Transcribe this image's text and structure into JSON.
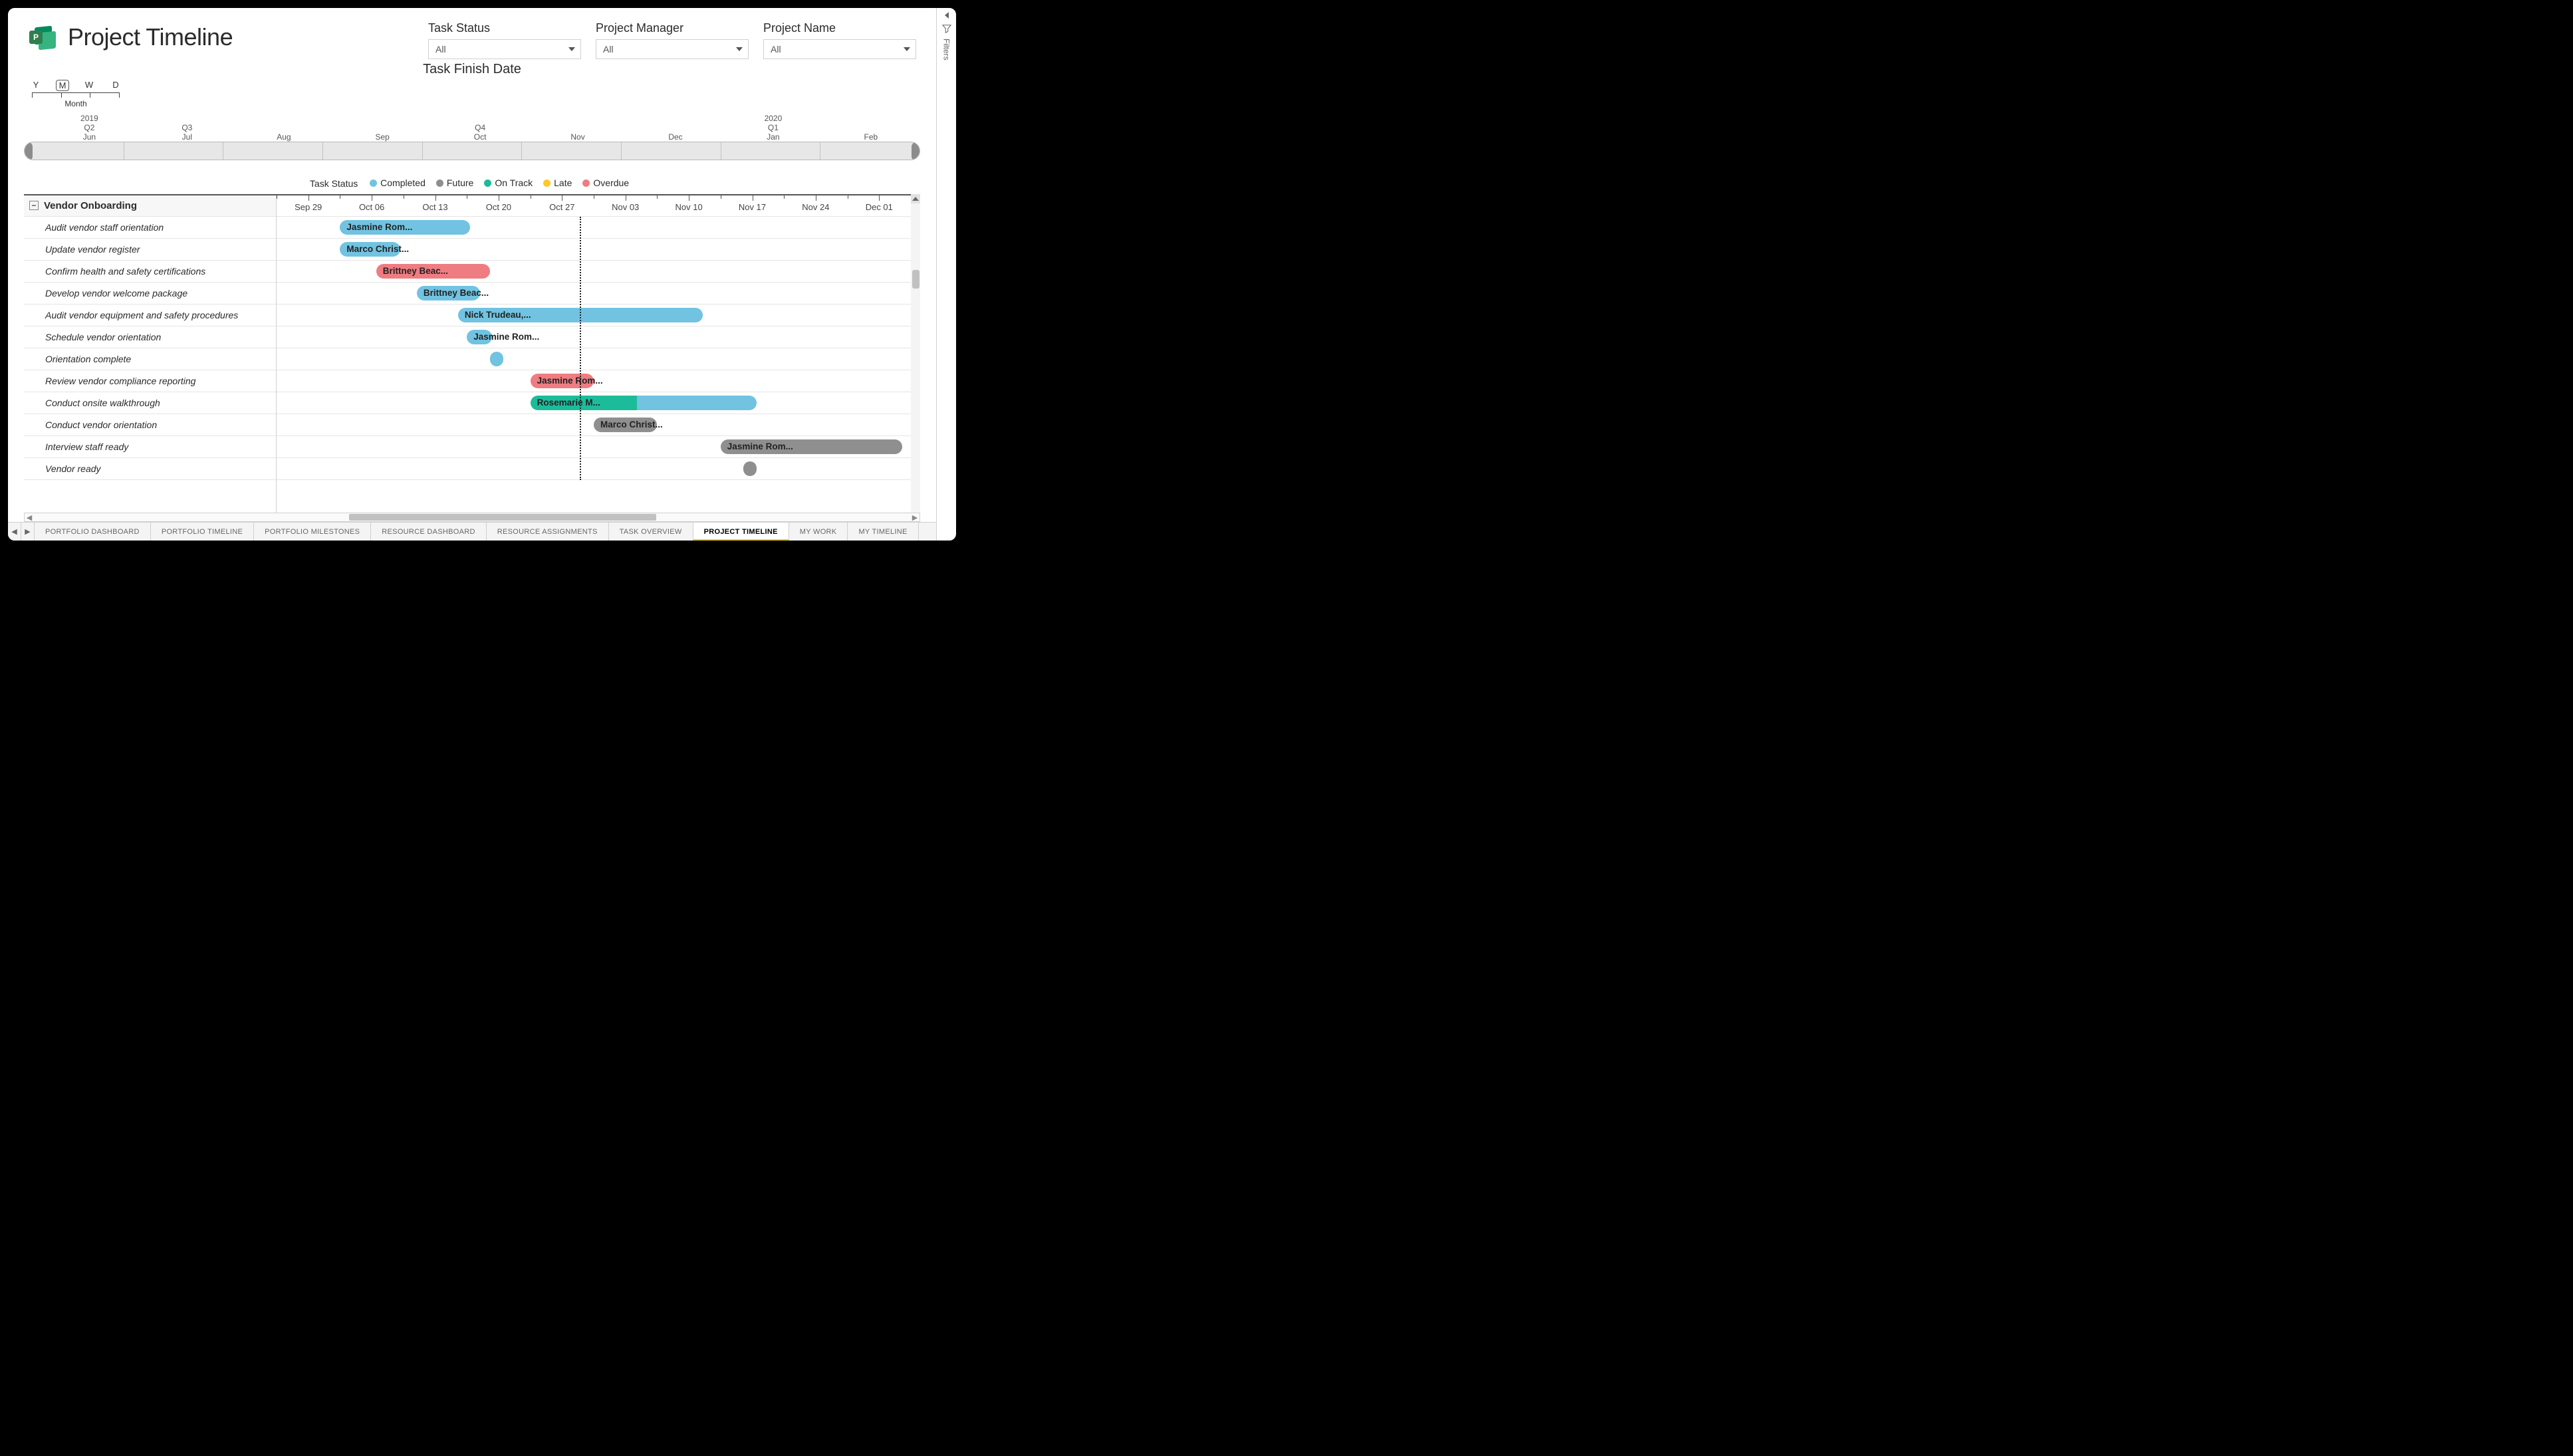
{
  "header": {
    "title": "Project Timeline",
    "logo_letter": "P"
  },
  "slicers": [
    {
      "label": "Task Status",
      "value": "All"
    },
    {
      "label": "Project Manager",
      "value": "All"
    },
    {
      "label": "Project Name",
      "value": "All"
    }
  ],
  "filters_panel_label": "Filters",
  "chart_title": "Task Finish Date",
  "granularity": {
    "options": [
      "Y",
      "M",
      "W",
      "D"
    ],
    "selected": "M",
    "selected_label": "Month"
  },
  "time_scroller": {
    "years": [
      {
        "label": "2019",
        "pos_pct": 7.3
      },
      {
        "label": "2020",
        "pos_pct": 83.6
      }
    ],
    "quarters": [
      {
        "label": "Q2",
        "pos_pct": 7.3
      },
      {
        "label": "Q3",
        "pos_pct": 18.2
      },
      {
        "label": "Q4",
        "pos_pct": 50.9
      },
      {
        "label": "Q1",
        "pos_pct": 83.6
      }
    ],
    "months": [
      {
        "label": "Jun",
        "pos_pct": 7.3
      },
      {
        "label": "Jul",
        "pos_pct": 18.2
      },
      {
        "label": "Aug",
        "pos_pct": 29.0
      },
      {
        "label": "Sep",
        "pos_pct": 40.0
      },
      {
        "label": "Oct",
        "pos_pct": 50.9
      },
      {
        "label": "Nov",
        "pos_pct": 61.8
      },
      {
        "label": "Dec",
        "pos_pct": 72.7
      },
      {
        "label": "Jan",
        "pos_pct": 83.6
      },
      {
        "label": "Feb",
        "pos_pct": 94.5
      }
    ]
  },
  "legend": {
    "title": "Task Status",
    "items": [
      {
        "label": "Completed",
        "color": "#71c3e1"
      },
      {
        "label": "Future",
        "color": "#8f8f8f"
      },
      {
        "label": "On Track",
        "color": "#1cbc9a"
      },
      {
        "label": "Late",
        "color": "#ffc828"
      },
      {
        "label": "Overdue",
        "color": "#ef7c81"
      }
    ]
  },
  "gantt": {
    "group": "Vendor Onboarding",
    "origin": "2019-09-26",
    "today_pct": 47.8,
    "date_ticks": [
      "Sep 29",
      "Oct 06",
      "Oct 13",
      "Oct 20",
      "Oct 27",
      "Nov 03",
      "Nov 10",
      "Nov 17",
      "Nov 24",
      "Dec 01"
    ],
    "tick_start_pct": 5,
    "tick_step_pct": 10,
    "tasks": [
      {
        "name": "Audit vendor staff orientation",
        "label": "Jasmine Rom...",
        "start_pct": 10.0,
        "width_pct": 20.5,
        "segments": [
          {
            "c": "completed",
            "pct": 100
          }
        ]
      },
      {
        "name": "Update vendor register",
        "label": "Marco Christ...",
        "start_pct": 10.0,
        "width_pct": 9.5,
        "segments": [
          {
            "c": "completed",
            "pct": 100
          }
        ]
      },
      {
        "name": "Confirm health and safety certifications",
        "label": "Brittney Beac...",
        "start_pct": 15.7,
        "width_pct": 18.0,
        "segments": [
          {
            "c": "overdue",
            "pct": 100
          }
        ]
      },
      {
        "name": "Develop vendor welcome package",
        "label": "Brittney Beac...",
        "start_pct": 22.1,
        "width_pct": 10.0,
        "segments": [
          {
            "c": "completed",
            "pct": 100
          }
        ]
      },
      {
        "name": "Audit vendor equipment and safety procedures",
        "label": "Nick Trudeau,...",
        "start_pct": 28.6,
        "width_pct": 38.6,
        "segments": [
          {
            "c": "completed",
            "pct": 100
          }
        ]
      },
      {
        "name": "Schedule vendor orientation",
        "label": "Jasmine Rom...",
        "start_pct": 30.0,
        "width_pct": 4.0,
        "segments": [
          {
            "c": "completed",
            "pct": 100
          }
        ]
      },
      {
        "name": "Orientation complete",
        "label": "",
        "start_pct": 33.6,
        "width_pct": 1.6,
        "segments": [
          {
            "c": "completed",
            "pct": 100
          }
        ]
      },
      {
        "name": "Review vendor compliance reporting",
        "label": "Jasmine Rom...",
        "start_pct": 40.0,
        "width_pct": 10.0,
        "segments": [
          {
            "c": "overdue",
            "pct": 100
          }
        ]
      },
      {
        "name": "Conduct onsite walkthrough",
        "label": "Rosemarie M...",
        "start_pct": 40.0,
        "width_pct": 35.7,
        "segments": [
          {
            "c": "ontrack",
            "pct": 47
          },
          {
            "c": "completed",
            "pct": 53
          }
        ]
      },
      {
        "name": "Conduct vendor orientation",
        "label": "Marco Christ...",
        "start_pct": 50.0,
        "width_pct": 10.0,
        "segments": [
          {
            "c": "future",
            "pct": 100
          }
        ]
      },
      {
        "name": "Interview staff ready",
        "label": "Jasmine Rom...",
        "start_pct": 70.0,
        "width_pct": 28.6,
        "segments": [
          {
            "c": "future",
            "pct": 100
          }
        ]
      },
      {
        "name": "Vendor ready",
        "label": "",
        "start_pct": 73.6,
        "width_pct": 1.6,
        "segments": [
          {
            "c": "future",
            "pct": 100
          }
        ]
      }
    ]
  },
  "hscroll": {
    "thumb_left_pct": 36,
    "thumb_width_pct": 35
  },
  "tabs": [
    "PORTFOLIO DASHBOARD",
    "PORTFOLIO TIMELINE",
    "PORTFOLIO MILESTONES",
    "RESOURCE DASHBOARD",
    "RESOURCE ASSIGNMENTS",
    "TASK OVERVIEW",
    "PROJECT TIMELINE",
    "MY WORK",
    "MY TIMELINE"
  ],
  "active_tab": "PROJECT TIMELINE",
  "chart_data": {
    "type": "gantt",
    "title": "Task Finish Date",
    "x_axis": {
      "start": "2019-09-26",
      "end": "2019-12-04",
      "ticks": [
        "2019-09-29",
        "2019-10-06",
        "2019-10-13",
        "2019-10-20",
        "2019-10-27",
        "2019-11-03",
        "2019-11-10",
        "2019-11-17",
        "2019-11-24",
        "2019-12-01"
      ]
    },
    "today": "2019-10-29",
    "group": "Vendor Onboarding",
    "legend": {
      "field": "Task Status",
      "categories": [
        "Completed",
        "Future",
        "On Track",
        "Late",
        "Overdue"
      ],
      "colors": [
        "#71c3e1",
        "#8f8f8f",
        "#1cbc9a",
        "#ffc828",
        "#ef7c81"
      ]
    },
    "tasks": [
      {
        "name": "Audit vendor staff orientation",
        "assignee": "Jasmine Rom...",
        "start": "2019-10-03",
        "end": "2019-10-17",
        "status": "Completed"
      },
      {
        "name": "Update vendor register",
        "assignee": "Marco Christ...",
        "start": "2019-10-03",
        "end": "2019-10-09",
        "status": "Completed"
      },
      {
        "name": "Confirm health and safety certifications",
        "assignee": "Brittney Beac...",
        "start": "2019-10-07",
        "end": "2019-10-19",
        "status": "Overdue"
      },
      {
        "name": "Develop vendor welcome package",
        "assignee": "Brittney Beac...",
        "start": "2019-10-11",
        "end": "2019-10-18",
        "status": "Completed"
      },
      {
        "name": "Audit vendor equipment and safety procedures",
        "assignee": "Nick Trudeau,...",
        "start": "2019-10-16",
        "end": "2019-11-12",
        "status": "Completed"
      },
      {
        "name": "Schedule vendor orientation",
        "assignee": "Jasmine Rom...",
        "start": "2019-10-17",
        "end": "2019-10-19",
        "status": "Completed"
      },
      {
        "name": "Orientation complete",
        "assignee": "",
        "start": "2019-10-19",
        "end": "2019-10-20",
        "status": "Completed"
      },
      {
        "name": "Review vendor compliance reporting",
        "assignee": "Jasmine Rom...",
        "start": "2019-10-24",
        "end": "2019-10-31",
        "status": "Overdue"
      },
      {
        "name": "Conduct onsite walkthrough",
        "assignee": "Rosemarie M...",
        "start": "2019-10-24",
        "end": "2019-11-18",
        "status": "On Track"
      },
      {
        "name": "Conduct vendor orientation",
        "assignee": "Marco Christ...",
        "start": "2019-10-31",
        "end": "2019-11-07",
        "status": "Future"
      },
      {
        "name": "Interview staff ready",
        "assignee": "Jasmine Rom...",
        "start": "2019-11-14",
        "end": "2019-12-04",
        "status": "Future"
      },
      {
        "name": "Vendor ready",
        "assignee": "",
        "start": "2019-11-16",
        "end": "2019-11-17",
        "status": "Future"
      }
    ]
  }
}
